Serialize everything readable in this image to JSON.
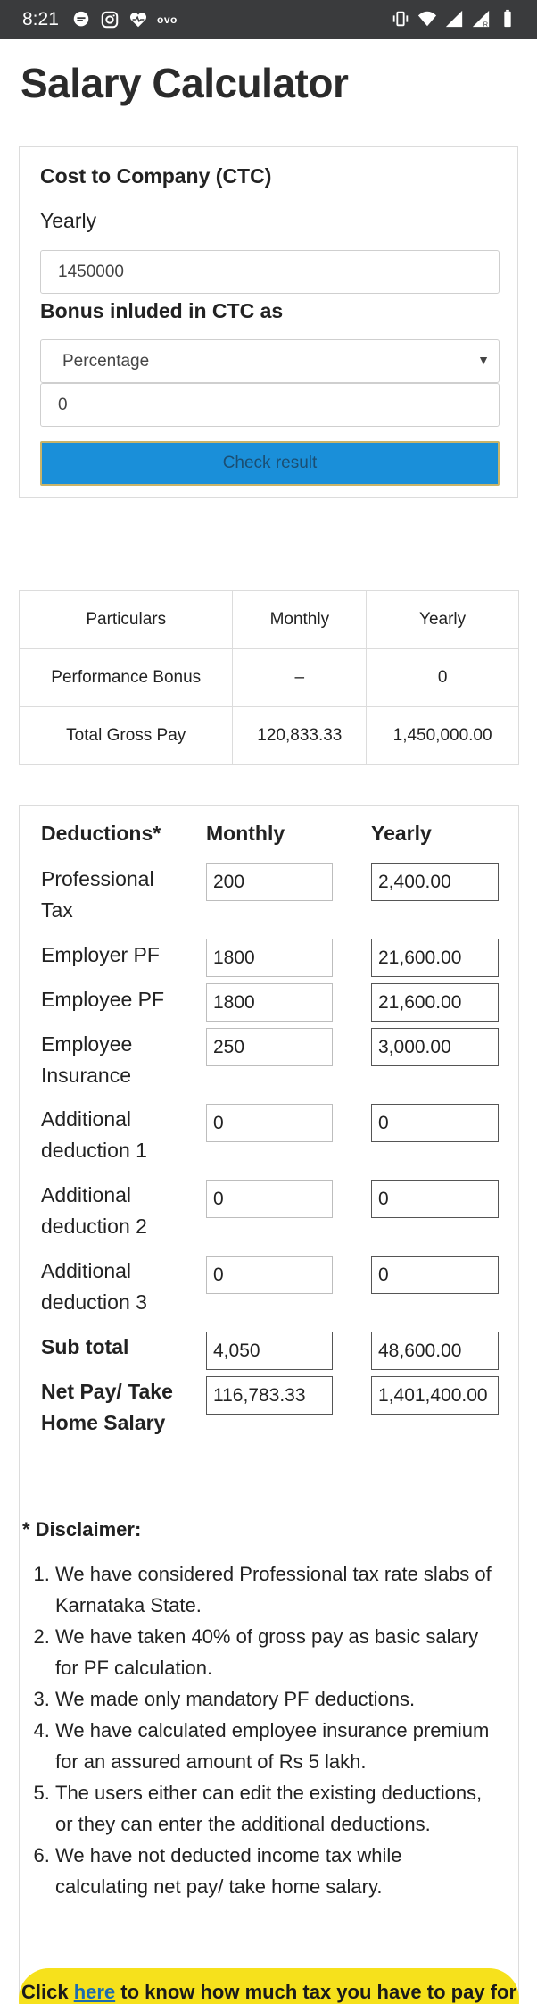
{
  "status_bar": {
    "time": "8:21",
    "ovo": "ovo"
  },
  "page_title": "Salary Calculator",
  "ctc": {
    "heading": "Cost to Company (CTC)",
    "period_label": "Yearly",
    "amount": "1450000",
    "bonus_heading": "Bonus inluded in CTC as",
    "bonus_type": "Percentage",
    "bonus_value": "0",
    "check_button": "Check result"
  },
  "pay_table": {
    "headers": [
      "Particulars",
      "Monthly",
      "Yearly"
    ],
    "rows": [
      [
        "Performance Bonus",
        "–",
        "0"
      ],
      [
        "Total Gross Pay",
        "120,833.33",
        "1,450,000.00"
      ]
    ]
  },
  "deductions": {
    "headers": [
      "Deductions*",
      "Monthly",
      "Yearly"
    ],
    "rows": [
      {
        "label": "Professional Tax",
        "monthly": "200",
        "yearly": "2,400.00"
      },
      {
        "label": "Employer PF",
        "monthly": "1800",
        "yearly": "21,600.00"
      },
      {
        "label": "Employee PF",
        "monthly": "1800",
        "yearly": "21,600.00"
      },
      {
        "label": "Employee Insurance",
        "monthly": "250",
        "yearly": "3,000.00"
      },
      {
        "label": "Additional deduction 1",
        "monthly": "0",
        "yearly": "0"
      },
      {
        "label": "Additional deduction 2",
        "monthly": "0",
        "yearly": "0"
      },
      {
        "label": "Additional deduction 3",
        "monthly": "0",
        "yearly": "0"
      }
    ],
    "subtotal": {
      "label": "Sub total",
      "monthly": "4,050",
      "yearly": "48,600.00"
    },
    "net_pay": {
      "label": "Net Pay/ Take Home Salary",
      "monthly": "116,783.33",
      "yearly": "1,401,400.00"
    }
  },
  "disclaimer": {
    "heading": "* Disclaimer:",
    "items": [
      "We have considered Professional tax rate slabs of Karnataka State.",
      "We have taken 40% of gross pay as basic salary for PF calculation.",
      "We made only mandatory PF deductions.",
      "We have calculated employee insurance premium for an assured amount of Rs 5 lakh.",
      "The users either can edit the existing deductions, or they can enter the additional deductions.",
      "We have not deducted income tax while calculating net pay/ take home salary."
    ]
  },
  "cta": {
    "prefix": "Click ",
    "link": "here",
    "suffix": " to know how much tax you have to pay for"
  }
}
